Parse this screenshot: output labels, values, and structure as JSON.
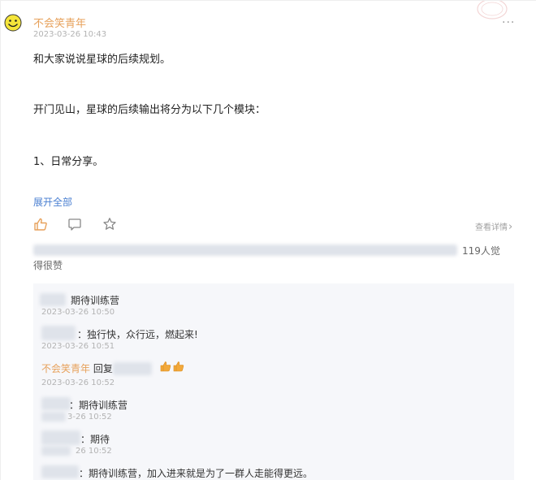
{
  "post": {
    "author": "不会笑青年",
    "time": "2023-03-26 10:43",
    "more": "···",
    "lines": [
      "和大家说说星球的后续规划。",
      "开门见山，星球的后续输出将分为以下几个模块：",
      "1、日常分享。"
    ],
    "expand": "展开全部"
  },
  "actions": {
    "details": "查看详情",
    "details_arrow": "›"
  },
  "likes": {
    "count_text": "119人觉",
    "tail": "得很赞"
  },
  "comments": [
    {
      "text": "期待训练营",
      "time": "2023-03-26 10:50"
    },
    {
      "text": "独行快，众行远，燃起来!",
      "time": "2023-03-26 10:51"
    },
    {
      "name": "不会笑青年",
      "reply": "回复",
      "time": "2023-03-26 10:52"
    },
    {
      "text": "：期待训练营",
      "time": "3-26 10:52"
    },
    {
      "text": "：期待",
      "time": "26 10:52"
    },
    {
      "text": "：期待训练营，加入进来就是为了一群人走能得更远。"
    }
  ]
}
